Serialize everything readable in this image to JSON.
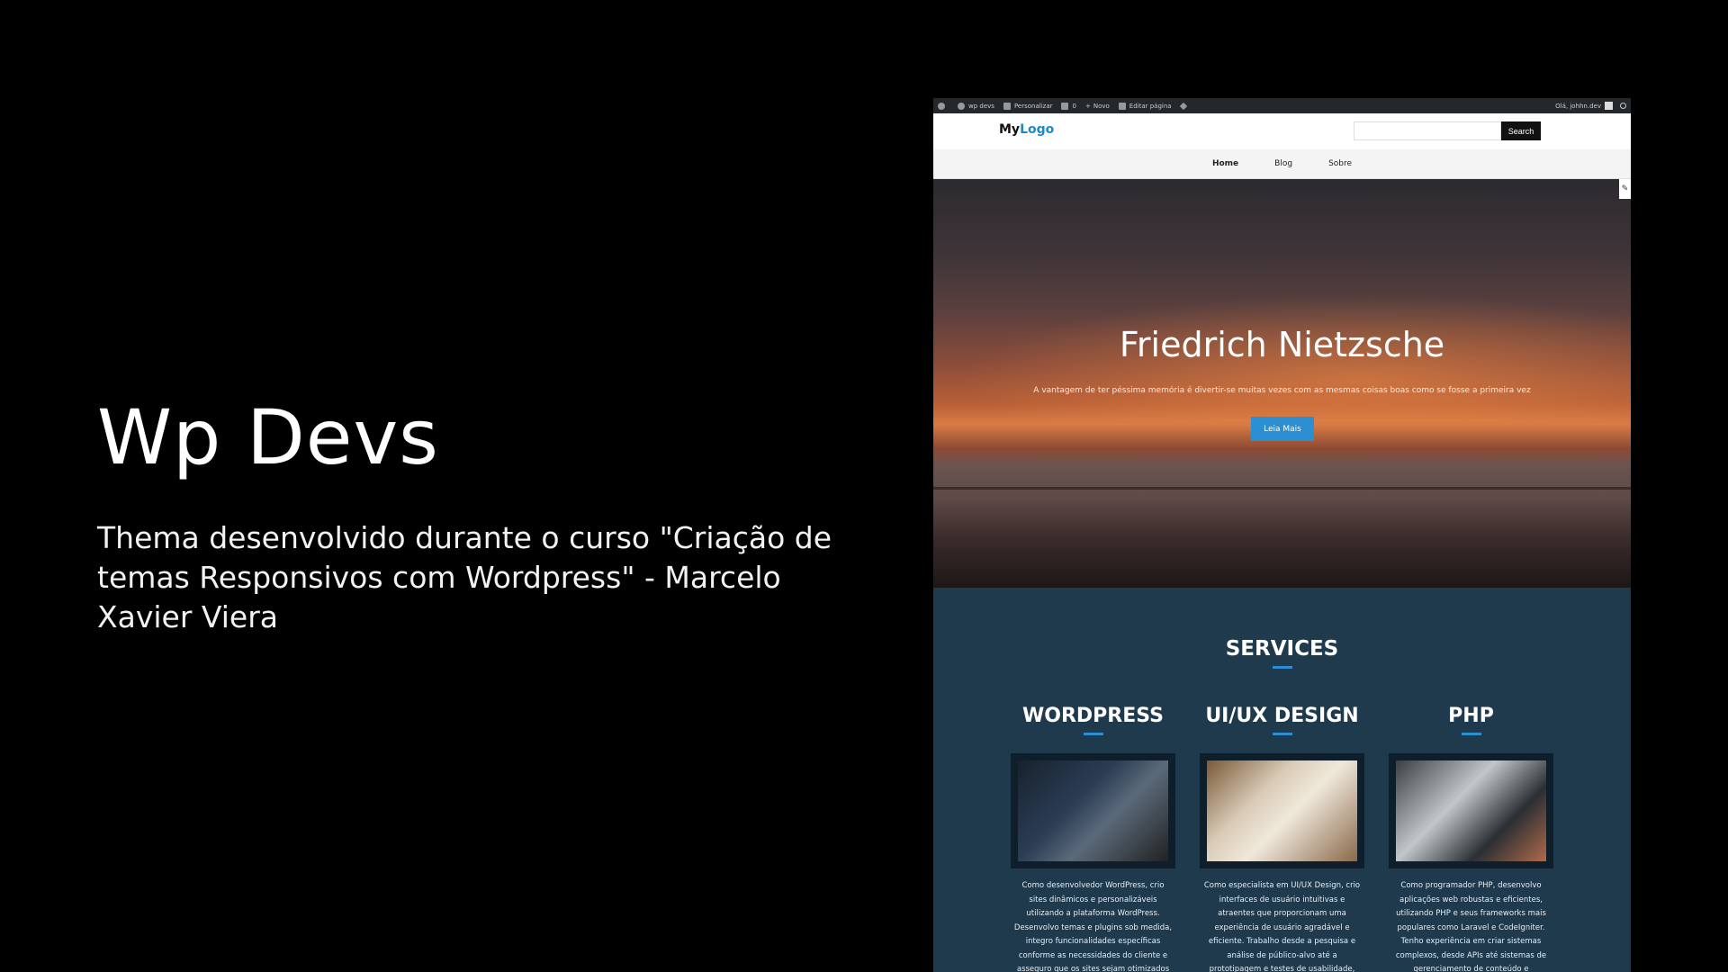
{
  "intro": {
    "title": "Wp Devs",
    "description": "Thema desenvolvido durante o curso \"Criação de temas Responsivos com Wordpress\" - Marcelo Xavier Viera"
  },
  "admin_bar": {
    "site": "wp devs",
    "customize": "Personalizar",
    "comments": "0",
    "new": "Novo",
    "edit_page": "Editar página",
    "greeting": "Olá, johhn.dev"
  },
  "header": {
    "logo_part1": "My",
    "logo_part2": "Logo",
    "search_button": "Search"
  },
  "nav": {
    "items": [
      "Home",
      "Blog",
      "Sobre"
    ]
  },
  "hero": {
    "title": "Friedrich Nietzsche",
    "quote": "A vantagem de ter péssima memória é divertir-se muitas vezes com as mesmas coisas boas como se fosse a primeira vez",
    "button": "Leia Mais"
  },
  "services": {
    "title": "SERVICES",
    "cards": [
      {
        "title": "WORDPRESS",
        "text": "Como desenvolvedor WordPress, crio sites dinâmicos e personalizáveis utilizando a plataforma WordPress. Desenvolvo temas e plugins sob medida, integro funcionalidades específicas conforme as necessidades do cliente e asseguro que os sites sejam otimizados para SEO,"
      },
      {
        "title": "UI/UX DESIGN",
        "text": "Como especialista em UI/UX Design, crio interfaces de usuário intuitivas e atraentes que proporcionam uma experiência de usuário agradável e eficiente. Trabalho desde a pesquisa e análise de público-alvo até a prototipagem e testes de usabilidade,"
      },
      {
        "title": "PHP",
        "text": "Como programador PHP, desenvolvo aplicações web robustas e eficientes, utilizando PHP e seus frameworks mais populares como Laravel e CodeIgniter. Tenho experiência em criar sistemas complexos, desde APIs até sistemas de gerenciamento de conteúdo e"
      }
    ]
  },
  "colors": {
    "accent": "#2b8fd2",
    "services_bg": "#1f3a4d",
    "admin_bar_bg": "#23282d"
  }
}
